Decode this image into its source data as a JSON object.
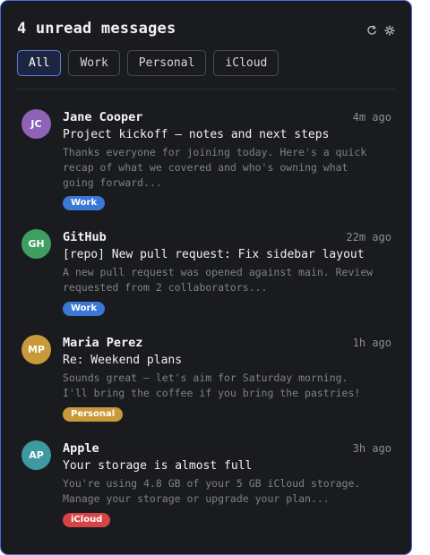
{
  "header": {
    "title": "4 unread messages",
    "icons": [
      "refresh-icon",
      "settings-icon"
    ]
  },
  "filters": {
    "active": "All",
    "items": [
      {
        "label": "All"
      },
      {
        "label": "Work"
      },
      {
        "label": "Personal"
      },
      {
        "label": "iCloud"
      }
    ]
  },
  "colors": {
    "accent": "#5a7fe8",
    "work": "#3a78d6",
    "personal": "#c99a3a",
    "icloud": "#d64545"
  },
  "messages": [
    {
      "initials": "JC",
      "avatar_color": "#8e62b8",
      "sender": "Jane Cooper",
      "time": "4m ago",
      "subject": "Project kickoff — notes and next steps",
      "preview": "Thanks everyone for joining today. Here's a quick recap of what we covered and who's owning what going forward...",
      "tag": "Work",
      "tag_color": "#3a78d6"
    },
    {
      "initials": "GH",
      "avatar_color": "#3f9e62",
      "sender": "GitHub",
      "time": "22m ago",
      "subject": "[repo] New pull request: Fix sidebar layout",
      "preview": "A new pull request was opened against main. Review requested from 2 collaborators...",
      "tag": "Work",
      "tag_color": "#3a78d6"
    },
    {
      "initials": "MP",
      "avatar_color": "#c99a3a",
      "sender": "Maria Perez",
      "time": "1h ago",
      "subject": "Re: Weekend plans",
      "preview": "Sounds great — let's aim for Saturday morning. I'll bring the coffee if you bring the pastries!",
      "tag": "Personal",
      "tag_color": "#c99a3a"
    },
    {
      "initials": "AP",
      "avatar_color": "#3d9aa0",
      "sender": "Apple",
      "time": "3h ago",
      "subject": "Your storage is almost full",
      "preview": "You're using 4.8 GB of your 5 GB iCloud storage. Manage your storage or upgrade your plan...",
      "tag": "iCloud",
      "tag_color": "#d64545"
    }
  ]
}
